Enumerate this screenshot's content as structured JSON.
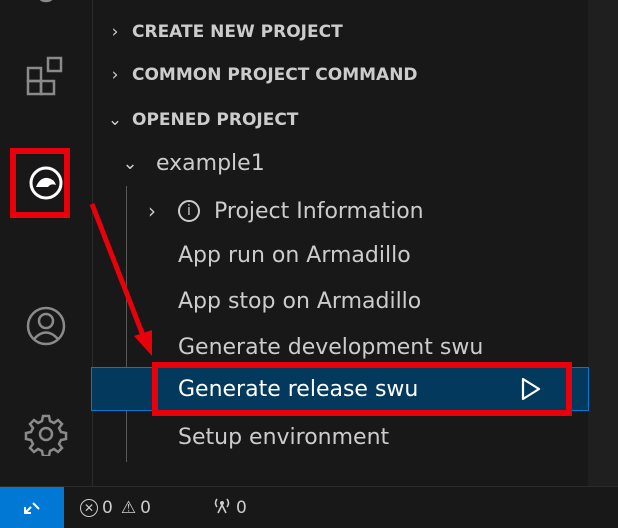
{
  "activity_bar": {
    "icons": [
      "extensions-icon",
      "armadillo-icon",
      "account-icon",
      "settings-icon"
    ]
  },
  "sidebar": {
    "sections": [
      {
        "label": "CREATE NEW PROJECT",
        "expanded": false
      },
      {
        "label": "COMMON PROJECT COMMAND",
        "expanded": false
      },
      {
        "label": "OPENED PROJECT",
        "expanded": true
      }
    ],
    "project": {
      "name": "example1",
      "items": [
        {
          "label": "Project Information",
          "has_children": true,
          "icon": "info-icon"
        },
        {
          "label": "App run on Armadillo"
        },
        {
          "label": "App stop on Armadillo"
        },
        {
          "label": "Generate development swu"
        },
        {
          "label": "Generate release swu",
          "selected": true,
          "action_icon": "run-icon"
        },
        {
          "label": "Setup environment"
        }
      ]
    }
  },
  "status_bar": {
    "errors": "0",
    "warnings": "0",
    "ports": "0"
  },
  "colors": {
    "accent": "#0078d4",
    "selection": "#04395e",
    "highlight": "#e8000b"
  }
}
